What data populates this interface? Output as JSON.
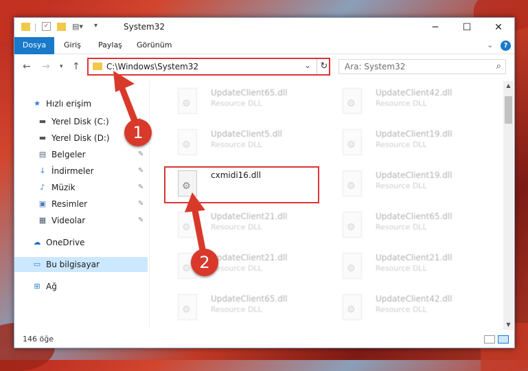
{
  "window": {
    "title": "System32",
    "minimize": "─",
    "maximize": "☐",
    "close": "✕"
  },
  "ribbon": {
    "tabs": [
      "Dosya",
      "Giriş",
      "Paylaş",
      "Görünüm"
    ],
    "collapse": "⌄",
    "help": "?"
  },
  "address": {
    "path": "C:\\Windows\\System32",
    "dropdown": "⌄",
    "refresh": "↻"
  },
  "search": {
    "placeholder": "Ara: System32"
  },
  "sidebar": {
    "items": [
      {
        "label": "Hızlı erişim",
        "icon": "star-icon",
        "glyph": "★",
        "color": "#2f7fd6"
      },
      {
        "label": "Yerel Disk (C:)",
        "icon": "drive-icon",
        "glyph": "▬",
        "color": "#555555",
        "pinned": true
      },
      {
        "label": "Yerel Disk (D:)",
        "icon": "drive-icon",
        "glyph": "▬",
        "color": "#555555",
        "pinned": true
      },
      {
        "label": "Belgeler",
        "icon": "documents-icon",
        "glyph": "▤",
        "color": "#5a6b8a",
        "pinned": true
      },
      {
        "label": "İndirmeler",
        "icon": "download-icon",
        "glyph": "↓",
        "color": "#2f7fd6",
        "pinned": true
      },
      {
        "label": "Müzik",
        "icon": "music-icon",
        "glyph": "♪",
        "color": "#2f7fd6",
        "pinned": true
      },
      {
        "label": "Resimler",
        "icon": "pictures-icon",
        "glyph": "▣",
        "color": "#4a7db8",
        "pinned": true
      },
      {
        "label": "Videolar",
        "icon": "video-icon",
        "glyph": "▦",
        "color": "#4a5a70",
        "pinned": true
      },
      {
        "label": "OneDrive",
        "icon": "cloud-icon",
        "glyph": "☁",
        "color": "#1e6fc8"
      },
      {
        "label": "Bu bilgisayar",
        "icon": "computer-icon",
        "glyph": "▭",
        "color": "#2f7fd6",
        "selected": true
      },
      {
        "label": "Ağ",
        "icon": "network-icon",
        "glyph": "⊞",
        "color": "#2f7fd6"
      }
    ]
  },
  "files": [
    {
      "name": "UpdateClient65.dll",
      "type": "Resource DLL"
    },
    {
      "name": "UpdateClient42.dll",
      "type": "Resource DLL"
    },
    {
      "name": "UpdateClient5.dll",
      "type": "Resource DLL"
    },
    {
      "name": "UpdateClient19.dll",
      "type": "Resource DLL"
    },
    {
      "name": "cxmidi16.dll",
      "type": "",
      "highlighted": true
    },
    {
      "name": "UpdateClient19.dll",
      "type": "Resource DLL"
    },
    {
      "name": "UpdateClient21.dll",
      "type": "Resource DLL"
    },
    {
      "name": "UpdateClient65.dll",
      "type": "Resource DLL"
    },
    {
      "name": "UpdateClient21.dll",
      "type": "Resource DLL"
    },
    {
      "name": "UpdateClient21.dll",
      "type": "Resource DLL"
    },
    {
      "name": "UpdateClient65.dll",
      "type": "Resource DLL"
    },
    {
      "name": "UpdateClient42.dll",
      "type": "Resource DLL"
    }
  ],
  "status": {
    "count": "146 öğe"
  },
  "annotations": {
    "step1": "1",
    "step2": "2",
    "color": "#d9392b"
  }
}
